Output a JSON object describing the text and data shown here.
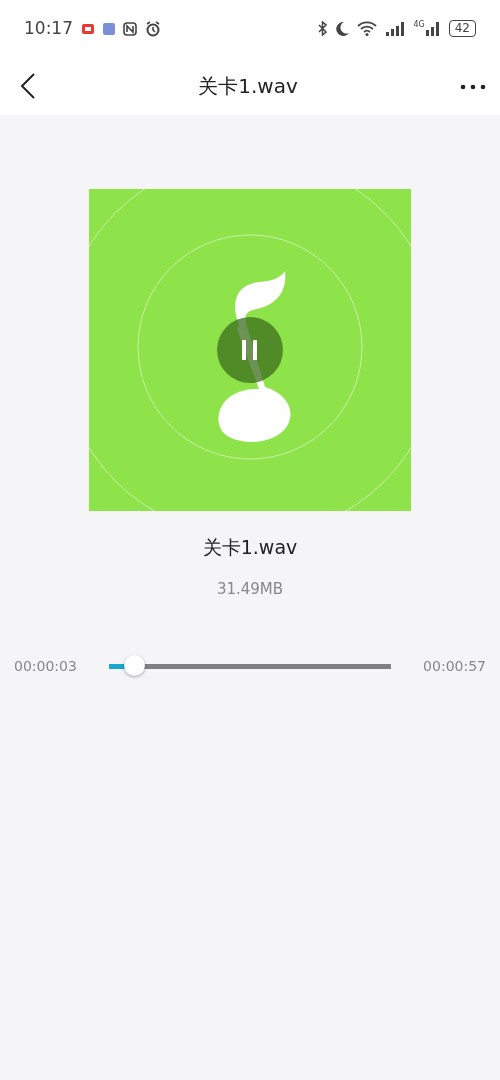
{
  "status_bar": {
    "time": "10:17",
    "network": "4G",
    "battery": "42"
  },
  "header": {
    "title": "关卡1.wav"
  },
  "player": {
    "playing": true,
    "file_name": "关卡1.wav",
    "file_size": "31.49MB"
  },
  "progress": {
    "elapsed": "00:00:03",
    "level": 0.09,
    "duration": "00:00:57"
  }
}
